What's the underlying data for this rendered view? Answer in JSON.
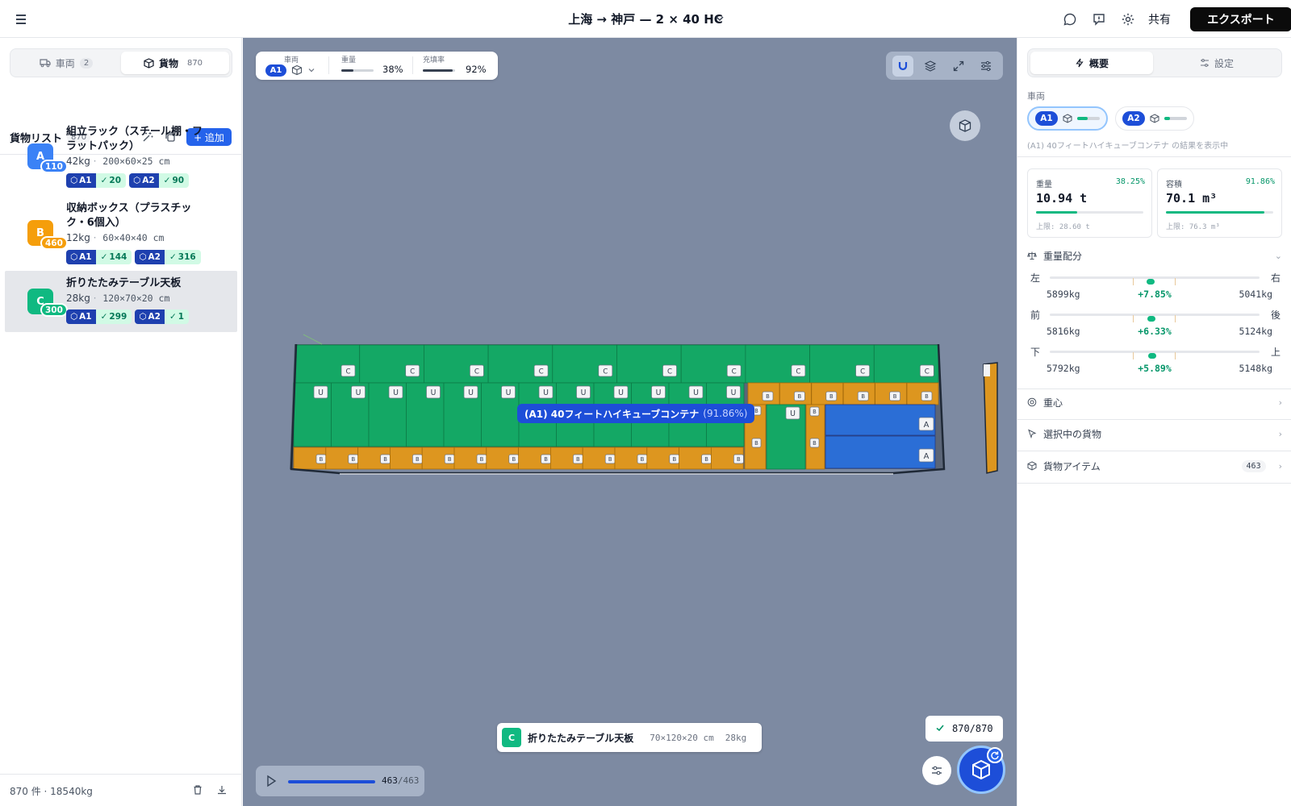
{
  "header": {
    "title": "上海 → 神戸 — 2 × 40 HC",
    "share_label": "共有",
    "export_label": "エクスポート"
  },
  "left": {
    "tabs": [
      {
        "label": "車両",
        "count": "2"
      },
      {
        "label": "貨物",
        "count": "870"
      }
    ],
    "list_title": "貨物リスト",
    "list_count": "870",
    "add_label": "+ 追加",
    "items": [
      {
        "badge": "A",
        "qty": "110",
        "color": "#3b82f6",
        "name": "組立ラック（スチール棚・フラットパック）",
        "weight": "42kg",
        "dims": "200×60×25 cm",
        "chips": [
          {
            "v": "A1",
            "n": "20"
          },
          {
            "v": "A2",
            "n": "90"
          }
        ]
      },
      {
        "badge": "B",
        "qty": "460",
        "color": "#f59e0b",
        "name": "収納ボックス（プラスチック・6個入）",
        "weight": "12kg",
        "dims": "60×40×40 cm",
        "chips": [
          {
            "v": "A1",
            "n": "144"
          },
          {
            "v": "A2",
            "n": "316"
          }
        ]
      },
      {
        "badge": "C",
        "qty": "300",
        "color": "#10b981",
        "name": "折りたたみテーブル天板",
        "weight": "28kg",
        "dims": "120×70×20 cm",
        "chips": [
          {
            "v": "A1",
            "n": "299"
          },
          {
            "v": "A2",
            "n": "1"
          }
        ]
      }
    ],
    "footer": "870 件 · 18540kg"
  },
  "viewport": {
    "stats": {
      "vehicle_label": "車両",
      "vehicle": "A1",
      "weight_label": "重量",
      "weight_value": "38%",
      "weight_fraction": 0.38,
      "fill_label": "充填率",
      "fill_value": "92%",
      "fill_fraction": 0.92
    },
    "container_label": "(A1) 40フィートハイキューブコンテナ",
    "container_pct": "(91.86%)",
    "selected_cargo": {
      "badge": "C",
      "name": "折りたたみテーブル天板",
      "dims": "70×120×20 cm",
      "weight": "28kg"
    },
    "packed_count": "870/870",
    "playback": {
      "current": "463",
      "total": "/463",
      "fraction": 1.0
    },
    "box_labels": {
      "A": "A",
      "B": "B",
      "C": "C"
    },
    "colors": {
      "A": "#2b6ed6",
      "B": "#dd961f",
      "C": "#14a865"
    }
  },
  "right": {
    "tabs": [
      "概要",
      "設定"
    ],
    "vehicle_section": "車両",
    "vehicles": [
      {
        "id": "A1",
        "load": 0.45
      },
      {
        "id": "A2",
        "load": 0.25
      }
    ],
    "vehicle_note": "(A1) 40フィートハイキューブコンテナ の結果を表示中",
    "weight_card": {
      "label": "重量",
      "pct": "38.25%",
      "value": "10.94 t",
      "limit": "上限: 28.60 t",
      "fraction": 0.3825
    },
    "volume_card": {
      "label": "容積",
      "pct": "91.86%",
      "value": "70.1 m³",
      "limit": "上限: 76.3 m³",
      "fraction": 0.9186
    },
    "balance_title": "重量配分",
    "balance": [
      {
        "left": "左",
        "right": "右",
        "lv": "5899kg",
        "delta": "+7.85%",
        "rv": "5041kg",
        "pos": 0.48
      },
      {
        "left": "前",
        "right": "後",
        "lv": "5816kg",
        "delta": "+6.33%",
        "rv": "5124kg",
        "pos": 0.485
      },
      {
        "left": "下",
        "right": "上",
        "lv": "5792kg",
        "delta": "+5.89%",
        "rv": "5148kg",
        "pos": 0.487
      }
    ],
    "cog_title": "重心",
    "selected_title": "選択中の貨物",
    "items_title": "貨物アイテム",
    "items_count": "463"
  }
}
